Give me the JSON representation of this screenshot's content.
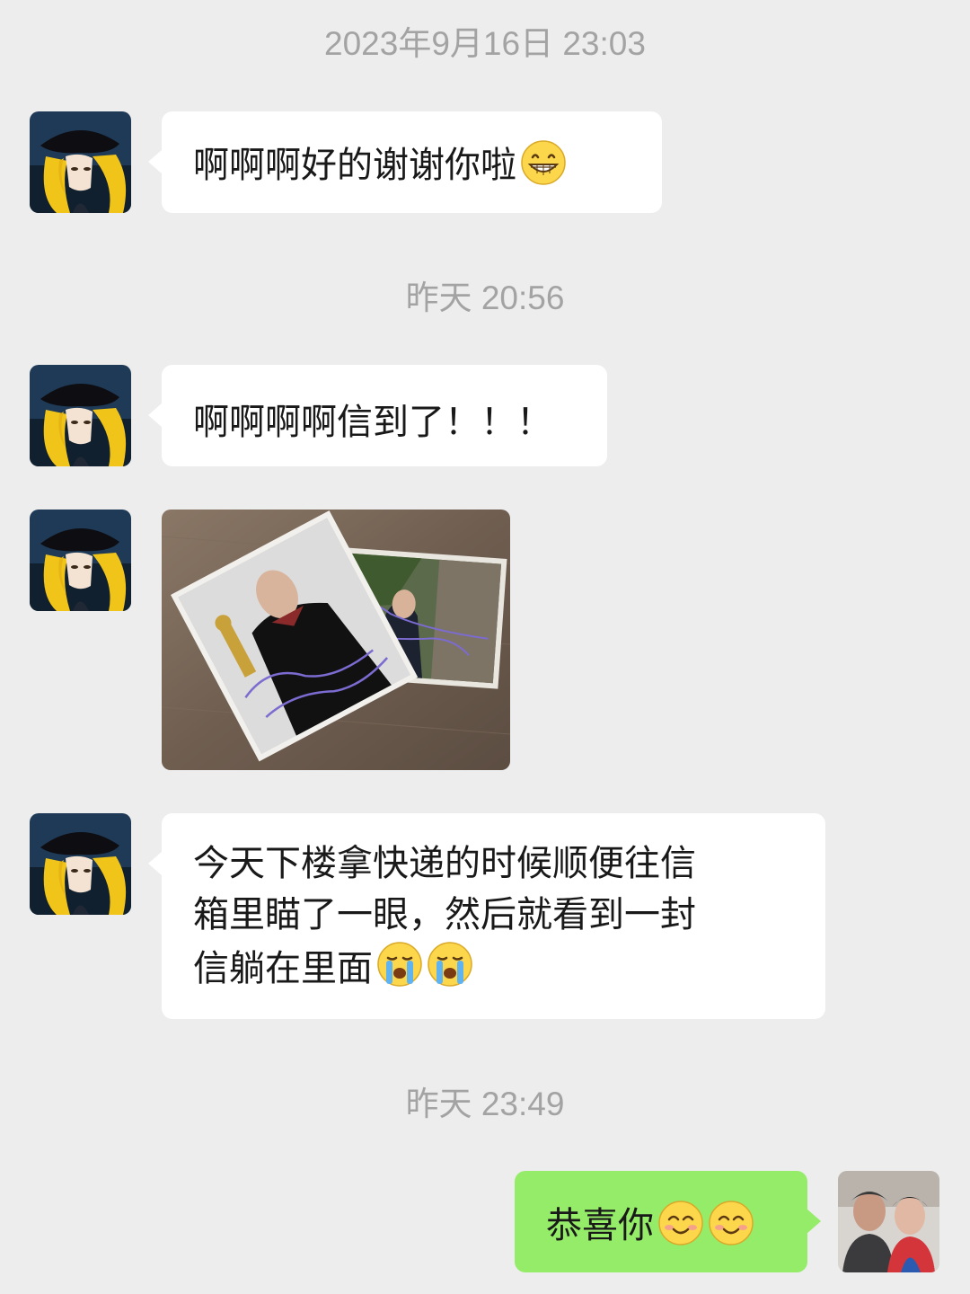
{
  "conversation": {
    "timestamps": [
      "2023年9月16日 23:03",
      "昨天 20:56",
      "昨天 23:49"
    ],
    "messages": [
      {
        "sender": "other",
        "text": "啊啊啊好的谢谢你啦",
        "emojis": [
          "grin-emoji"
        ]
      },
      {
        "sender": "other",
        "text": "啊啊啊啊信到了！！！",
        "emojis": []
      },
      {
        "sender": "other",
        "type": "image",
        "image_description": "two autographed photos on a wooden table"
      },
      {
        "sender": "other",
        "lines": [
          "今天下楼拿快递的时候顺便往信",
          "箱里瞄了一眼，然后就看到一封",
          "信躺在里面"
        ],
        "emojis": [
          "crying-emoji",
          "crying-emoji"
        ]
      },
      {
        "sender": "me",
        "text": "恭喜你",
        "emojis": [
          "smile-emoji",
          "smile-emoji"
        ]
      }
    ]
  },
  "colors": {
    "background": "#ededed",
    "incoming_bubble": "#ffffff",
    "outgoing_bubble": "#95ec69",
    "timestamp_text": "#a3a3a3",
    "message_text": "#191919"
  }
}
